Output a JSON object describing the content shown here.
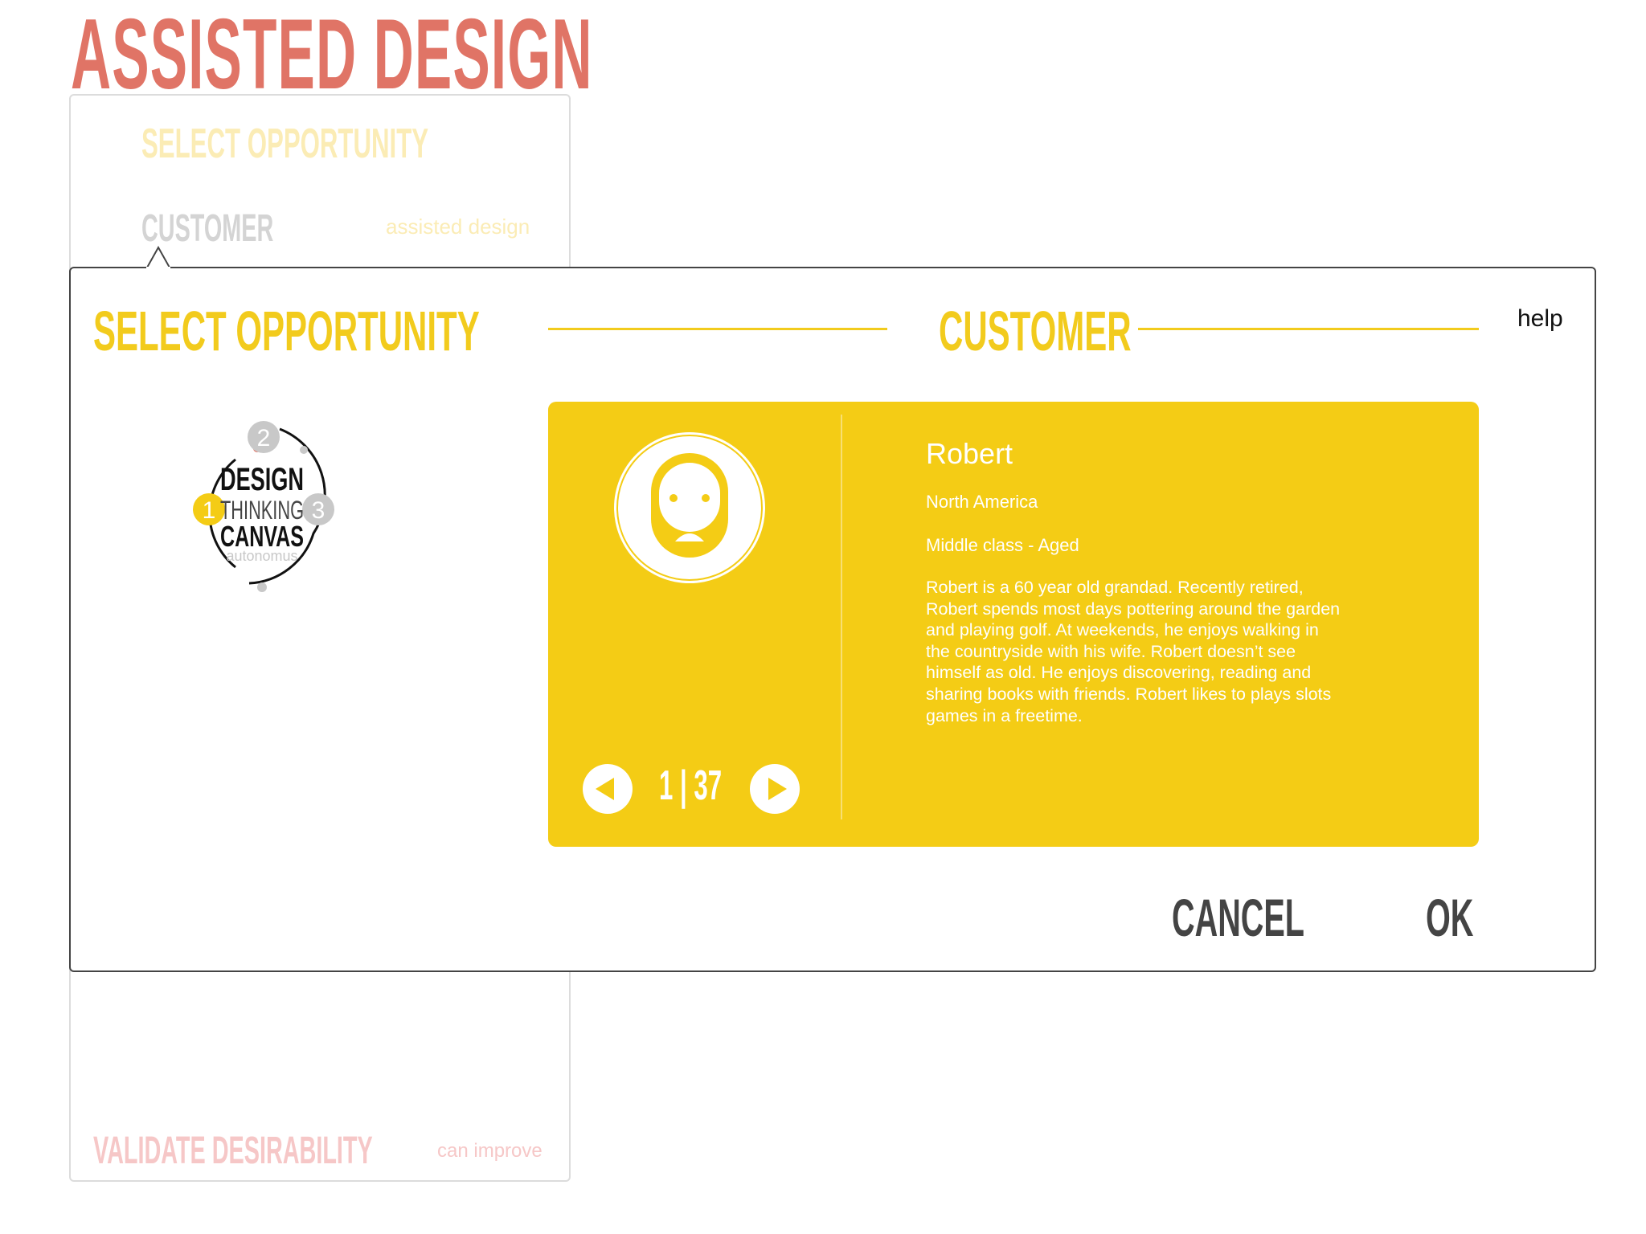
{
  "app": {
    "title": "ASSISTED DESIGN"
  },
  "background_panel": {
    "step1": "SELECT OPPORTUNITY",
    "step2": "CUSTOMER",
    "step2_tag": "assisted design",
    "step3": "VALIDATE DESIRABILITY",
    "step3_tag": "can improve"
  },
  "dialog": {
    "step_label": "SELECT OPPORTUNITY",
    "title": "CUSTOMER",
    "help_label": "help",
    "logo": {
      "line1": "DESIGN",
      "line2": "THINKING",
      "line3": "CANVAS",
      "subtitle": "autonomus",
      "steps": [
        "1",
        "2",
        "3"
      ]
    },
    "persona": {
      "name": "Robert",
      "region": "North America",
      "segment": "Middle class - Aged",
      "bio_lines": [
        "Robert is a 60 year old grandad. Recently retired,",
        "Robert spends most days pottering around the garden",
        "and playing golf. At weekends, he enjoys walking in",
        "the countryside with his wife. Robert doesn’t see",
        "himself as old. He enjoys discovering, reading and",
        "sharing books with friends. Robert likes to plays slots",
        "games in a freetime."
      ],
      "avatar_icon": "bearded-man-avatar-icon"
    },
    "pager": {
      "current": "1",
      "separator": "|",
      "total": "37"
    },
    "cancel_label": "CANCEL",
    "ok_label": "OK"
  },
  "colors": {
    "brand_red": "#e07466",
    "accent_yellow": "#f4cc15",
    "title_yellow": "#f2cb1d",
    "dark_text": "#444444"
  }
}
